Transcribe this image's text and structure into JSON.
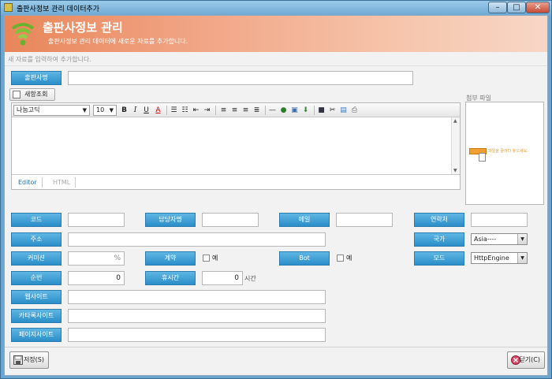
{
  "window": {
    "title": "출판사정보 관리 데이터추가",
    "minimize_glyph": "–",
    "maximize_glyph": "□",
    "close_glyph": "✕"
  },
  "banner": {
    "title": "출판사정보 관리",
    "subtitle": "출판사정보 관리 데이터에 새로운 자료를 추가합니다.",
    "logo_icon": "wifi-signal-icon"
  },
  "hint": "새 자료를 입력하여 추가합니다.",
  "publisher_name": {
    "label": "출판사명",
    "value": ""
  },
  "history_button": {
    "label": "새항조회"
  },
  "editor": {
    "font": "나눔고딕",
    "size": "10",
    "tools": [
      "B",
      "I",
      "U",
      "A"
    ],
    "tabs": [
      "Editor",
      "HTML"
    ]
  },
  "attach": {
    "label": "첨부 파일",
    "placeholder": "파일을 끌어다 놓으세요."
  },
  "fields": {
    "code": {
      "label": "코드",
      "value": ""
    },
    "manager": {
      "label": "담당자명",
      "value": ""
    },
    "email": {
      "label": "메일",
      "value": ""
    },
    "contact": {
      "label": "연락처",
      "value": ""
    },
    "address": {
      "label": "주소",
      "value": ""
    },
    "country": {
      "label": "국가",
      "value": "Asia----"
    },
    "commission": {
      "label": "커미션",
      "value": "",
      "unit": "%"
    },
    "contract": {
      "label": "계약",
      "check_label": "예"
    },
    "bot": {
      "label": "Bot",
      "check_label": "예"
    },
    "mode": {
      "label": "모드",
      "value": "HttpEngine"
    },
    "order": {
      "label": "순번",
      "value": "0"
    },
    "hours": {
      "label": "휴시간",
      "value": "0",
      "unit": "시간"
    },
    "website": {
      "label": "웹사이트",
      "value": ""
    },
    "catalog": {
      "label": "카타록사이트",
      "value": ""
    },
    "page": {
      "label": "페이지사이트",
      "value": ""
    }
  },
  "footer": {
    "save_label": "저장(S)",
    "close_label": "닫기(C)"
  },
  "colors": {
    "label_bg": "#2b8ec9",
    "banner": "#e8865a"
  }
}
